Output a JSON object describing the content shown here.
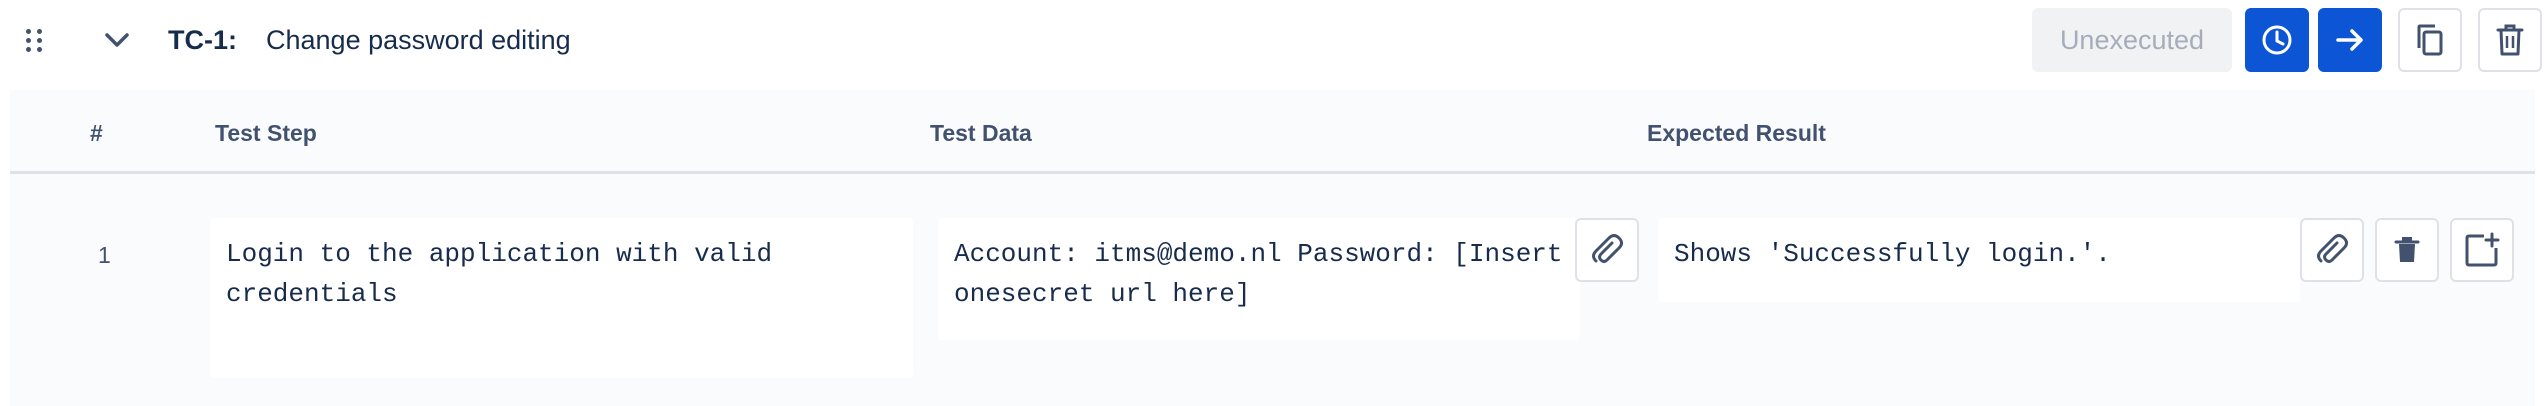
{
  "testcase": {
    "key": "TC-1:",
    "title": "Change password editing",
    "status_label": "Unexecuted"
  },
  "colors": {
    "primary": "#0c55d4",
    "status_bg": "#f1f2f4",
    "status_text": "#a5adba"
  },
  "icons": {
    "drag": "drag-handle-icon",
    "collapse": "chevron-down-icon",
    "history": "clock-icon",
    "next": "arrow-right-icon",
    "copy": "copy-icon",
    "delete": "trash-icon",
    "attach": "paperclip-icon",
    "add": "add-step-icon"
  },
  "table": {
    "columns": [
      "#",
      "Test Step",
      "Test Data",
      "Expected Result"
    ],
    "rows": [
      {
        "num": "1",
        "step": "Login to the application with valid credentials",
        "data": "Account: itms@demo.nl Password: [Insert onesecret url here]",
        "result": "Shows 'Successfully login.'."
      }
    ]
  }
}
